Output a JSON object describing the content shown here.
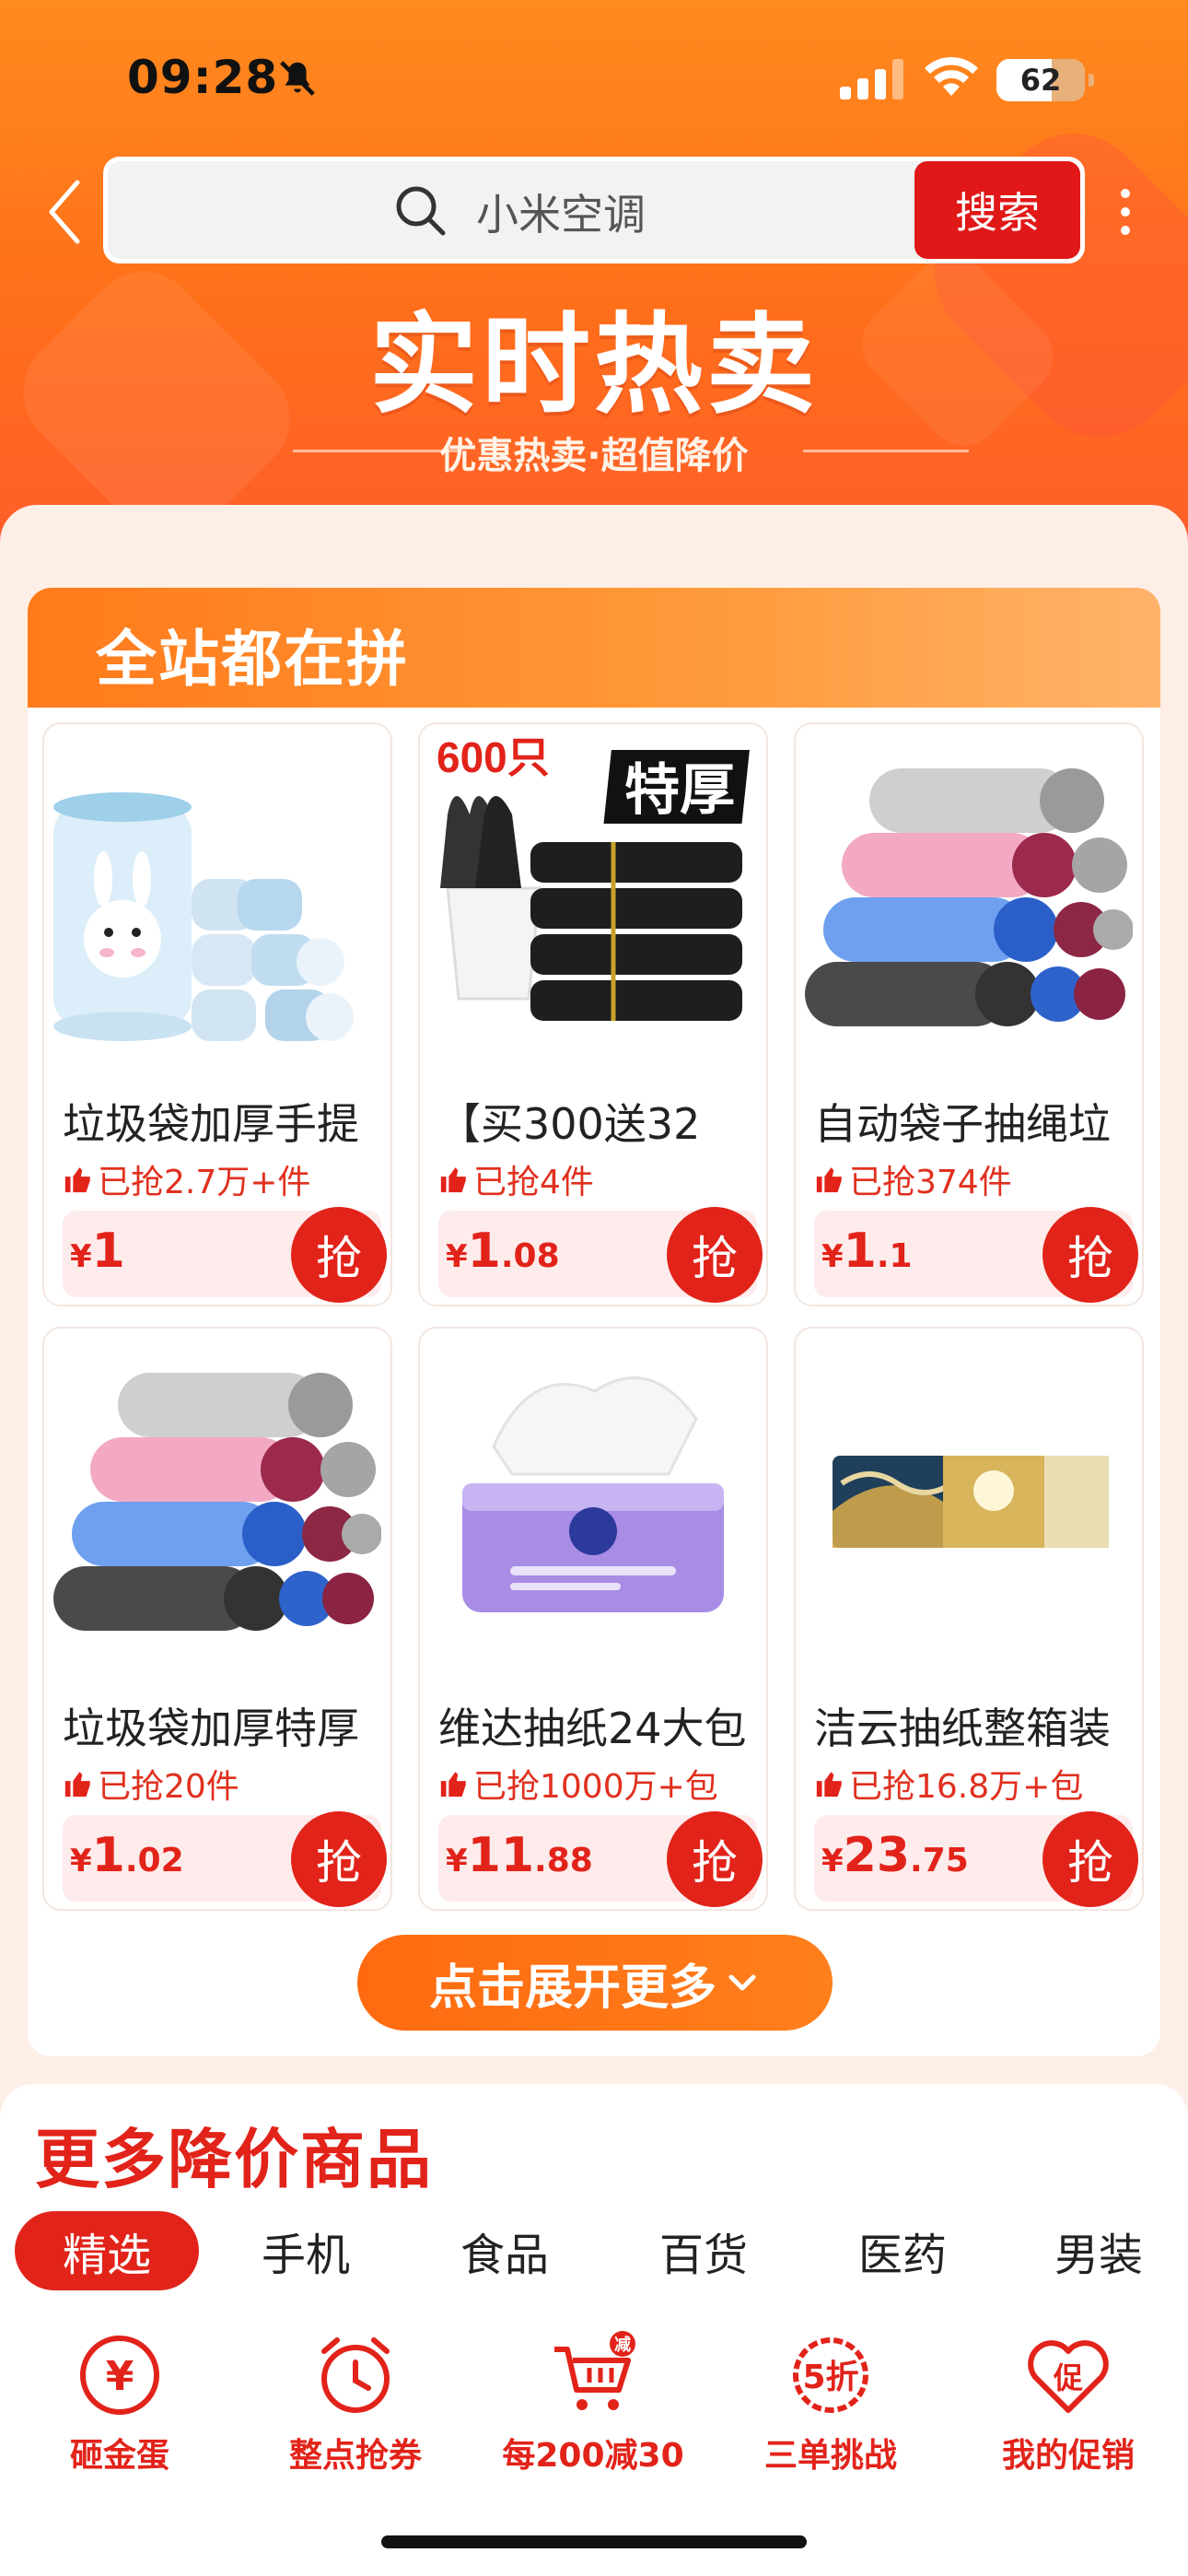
{
  "status_bar": {
    "time": "09:28",
    "battery": "62"
  },
  "search": {
    "placeholder": "小米空调",
    "button_label": "搜索"
  },
  "banner": {
    "title": "实时热卖",
    "subtitle": "优惠热卖·超值降价"
  },
  "section_card": {
    "title": "全站都在拼"
  },
  "products": [
    {
      "name": "垃圾袋加厚手提",
      "sold": "已抢2.7万+件",
      "currency": "¥",
      "price_int": "1",
      "price_dec": "",
      "grab": "抢",
      "img_badge": ""
    },
    {
      "name": "【买300送32",
      "sold": "已抢4件",
      "currency": "¥",
      "price_int": "1",
      "price_dec": ".08",
      "grab": "抢",
      "img_badge": "600只",
      "img_badge2": "特厚"
    },
    {
      "name": "自动袋子抽绳垃",
      "sold": "已抢374件",
      "currency": "¥",
      "price_int": "1",
      "price_dec": ".1",
      "grab": "抢",
      "img_badge": ""
    },
    {
      "name": "垃圾袋加厚特厚",
      "sold": "已抢20件",
      "currency": "¥",
      "price_int": "1",
      "price_dec": ".02",
      "grab": "抢",
      "img_badge": ""
    },
    {
      "name": "维达抽纸24大包",
      "sold": "已抢1000万+包",
      "currency": "¥",
      "price_int": "11",
      "price_dec": ".88",
      "grab": "抢",
      "img_badge": ""
    },
    {
      "name": "洁云抽纸整箱装",
      "sold": "已抢16.8万+包",
      "currency": "¥",
      "price_int": "23",
      "price_dec": ".75",
      "grab": "抢",
      "img_badge": ""
    }
  ],
  "expand_button": {
    "label": "点击展开更多"
  },
  "more_section": {
    "title": "更多降价商品"
  },
  "tabs": [
    {
      "label": "精选",
      "active": true
    },
    {
      "label": "手机",
      "active": false
    },
    {
      "label": "食品",
      "active": false
    },
    {
      "label": "百货",
      "active": false
    },
    {
      "label": "医药",
      "active": false
    },
    {
      "label": "男装",
      "active": false
    }
  ],
  "shortcuts": [
    {
      "label": "砸金蛋",
      "icon": "yen-coin-icon",
      "glyph": "¥"
    },
    {
      "label": "整点抢券",
      "icon": "alarm-clock-icon",
      "glyph": ""
    },
    {
      "label": "每200减30",
      "icon": "shopping-cart-discount-icon",
      "glyph": "减"
    },
    {
      "label": "三单挑战",
      "icon": "discount-50-icon",
      "glyph": "5折"
    },
    {
      "label": "我的促销",
      "icon": "promo-heart-icon",
      "glyph": "促"
    }
  ],
  "colors": {
    "accent_red": "#e2231a",
    "header_orange": "#ff7a1a",
    "panel_bg": "#fdeee6"
  }
}
